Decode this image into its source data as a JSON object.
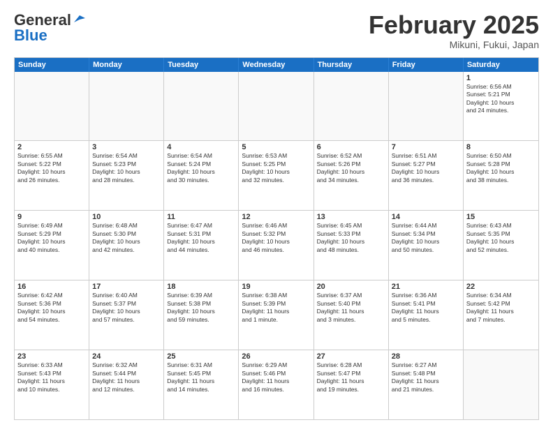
{
  "header": {
    "logo_general": "General",
    "logo_blue": "Blue",
    "month_title": "February 2025",
    "subtitle": "Mikuni, Fukui, Japan"
  },
  "weekdays": [
    "Sunday",
    "Monday",
    "Tuesday",
    "Wednesday",
    "Thursday",
    "Friday",
    "Saturday"
  ],
  "weeks": [
    [
      {
        "day": "",
        "empty": true
      },
      {
        "day": "",
        "empty": true
      },
      {
        "day": "",
        "empty": true
      },
      {
        "day": "",
        "empty": true
      },
      {
        "day": "",
        "empty": true
      },
      {
        "day": "",
        "empty": true
      },
      {
        "day": "1",
        "info": "Sunrise: 6:56 AM\nSunset: 5:21 PM\nDaylight: 10 hours\nand 24 minutes."
      }
    ],
    [
      {
        "day": "2",
        "info": "Sunrise: 6:55 AM\nSunset: 5:22 PM\nDaylight: 10 hours\nand 26 minutes."
      },
      {
        "day": "3",
        "info": "Sunrise: 6:54 AM\nSunset: 5:23 PM\nDaylight: 10 hours\nand 28 minutes."
      },
      {
        "day": "4",
        "info": "Sunrise: 6:54 AM\nSunset: 5:24 PM\nDaylight: 10 hours\nand 30 minutes."
      },
      {
        "day": "5",
        "info": "Sunrise: 6:53 AM\nSunset: 5:25 PM\nDaylight: 10 hours\nand 32 minutes."
      },
      {
        "day": "6",
        "info": "Sunrise: 6:52 AM\nSunset: 5:26 PM\nDaylight: 10 hours\nand 34 minutes."
      },
      {
        "day": "7",
        "info": "Sunrise: 6:51 AM\nSunset: 5:27 PM\nDaylight: 10 hours\nand 36 minutes."
      },
      {
        "day": "8",
        "info": "Sunrise: 6:50 AM\nSunset: 5:28 PM\nDaylight: 10 hours\nand 38 minutes."
      }
    ],
    [
      {
        "day": "9",
        "info": "Sunrise: 6:49 AM\nSunset: 5:29 PM\nDaylight: 10 hours\nand 40 minutes."
      },
      {
        "day": "10",
        "info": "Sunrise: 6:48 AM\nSunset: 5:30 PM\nDaylight: 10 hours\nand 42 minutes."
      },
      {
        "day": "11",
        "info": "Sunrise: 6:47 AM\nSunset: 5:31 PM\nDaylight: 10 hours\nand 44 minutes."
      },
      {
        "day": "12",
        "info": "Sunrise: 6:46 AM\nSunset: 5:32 PM\nDaylight: 10 hours\nand 46 minutes."
      },
      {
        "day": "13",
        "info": "Sunrise: 6:45 AM\nSunset: 5:33 PM\nDaylight: 10 hours\nand 48 minutes."
      },
      {
        "day": "14",
        "info": "Sunrise: 6:44 AM\nSunset: 5:34 PM\nDaylight: 10 hours\nand 50 minutes."
      },
      {
        "day": "15",
        "info": "Sunrise: 6:43 AM\nSunset: 5:35 PM\nDaylight: 10 hours\nand 52 minutes."
      }
    ],
    [
      {
        "day": "16",
        "info": "Sunrise: 6:42 AM\nSunset: 5:36 PM\nDaylight: 10 hours\nand 54 minutes."
      },
      {
        "day": "17",
        "info": "Sunrise: 6:40 AM\nSunset: 5:37 PM\nDaylight: 10 hours\nand 57 minutes."
      },
      {
        "day": "18",
        "info": "Sunrise: 6:39 AM\nSunset: 5:38 PM\nDaylight: 10 hours\nand 59 minutes."
      },
      {
        "day": "19",
        "info": "Sunrise: 6:38 AM\nSunset: 5:39 PM\nDaylight: 11 hours\nand 1 minute."
      },
      {
        "day": "20",
        "info": "Sunrise: 6:37 AM\nSunset: 5:40 PM\nDaylight: 11 hours\nand 3 minutes."
      },
      {
        "day": "21",
        "info": "Sunrise: 6:36 AM\nSunset: 5:41 PM\nDaylight: 11 hours\nand 5 minutes."
      },
      {
        "day": "22",
        "info": "Sunrise: 6:34 AM\nSunset: 5:42 PM\nDaylight: 11 hours\nand 7 minutes."
      }
    ],
    [
      {
        "day": "23",
        "info": "Sunrise: 6:33 AM\nSunset: 5:43 PM\nDaylight: 11 hours\nand 10 minutes."
      },
      {
        "day": "24",
        "info": "Sunrise: 6:32 AM\nSunset: 5:44 PM\nDaylight: 11 hours\nand 12 minutes."
      },
      {
        "day": "25",
        "info": "Sunrise: 6:31 AM\nSunset: 5:45 PM\nDaylight: 11 hours\nand 14 minutes."
      },
      {
        "day": "26",
        "info": "Sunrise: 6:29 AM\nSunset: 5:46 PM\nDaylight: 11 hours\nand 16 minutes."
      },
      {
        "day": "27",
        "info": "Sunrise: 6:28 AM\nSunset: 5:47 PM\nDaylight: 11 hours\nand 19 minutes."
      },
      {
        "day": "28",
        "info": "Sunrise: 6:27 AM\nSunset: 5:48 PM\nDaylight: 11 hours\nand 21 minutes."
      },
      {
        "day": "",
        "empty": true
      }
    ]
  ]
}
